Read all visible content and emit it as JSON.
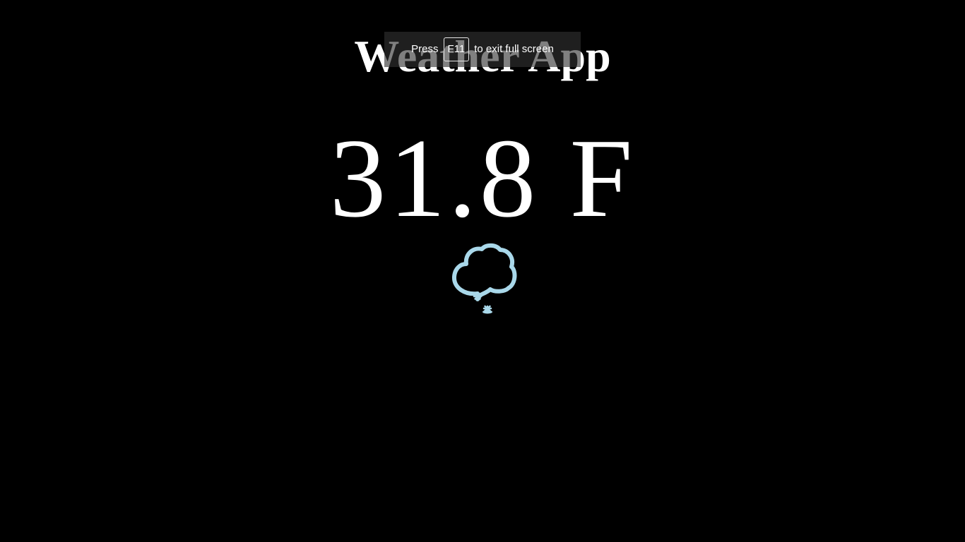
{
  "app": {
    "title": "Weather App"
  },
  "weather": {
    "temperature": "31.8 F",
    "condition_icon": "cloud-snow-icon",
    "icon_color": "#a9d8ea"
  },
  "fullscreen_notice": {
    "prefix": "Press",
    "key": "F11",
    "suffix": "to exit full screen"
  },
  "colors": {
    "background": "#000000",
    "text": "#ffffff"
  }
}
